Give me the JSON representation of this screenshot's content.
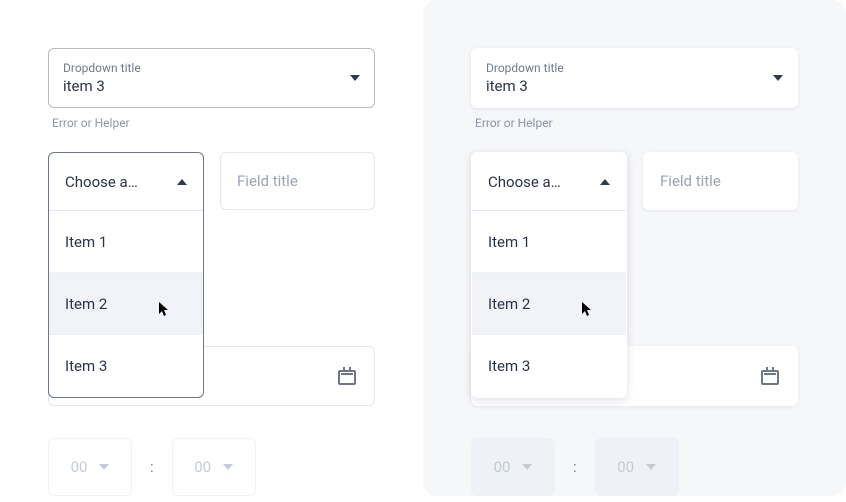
{
  "dropdown1": {
    "label": "Dropdown title",
    "value": "item 3",
    "helper": "Error or Helper"
  },
  "open_dropdown": {
    "label": "Choose a…",
    "items": [
      "Item 1",
      "Item 2",
      "Item 3"
    ],
    "hover_index": 1
  },
  "field": {
    "placeholder": "Field title"
  },
  "time": {
    "hh": "00",
    "mm": "00",
    "sep": ":"
  }
}
